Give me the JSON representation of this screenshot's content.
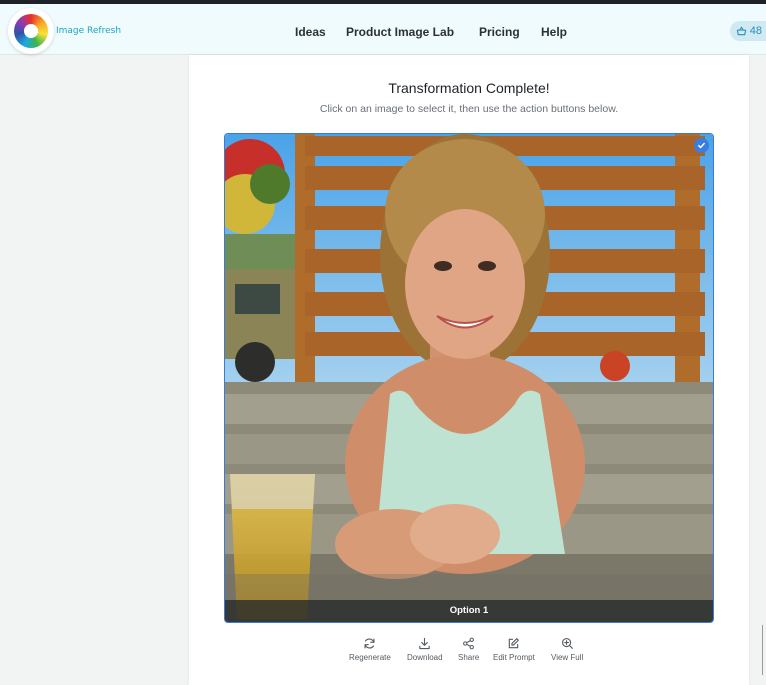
{
  "header": {
    "logo_text": "Image Refresh",
    "nav": [
      "Ideas",
      "Product Image Lab",
      "Pricing",
      "Help"
    ],
    "credits": "48"
  },
  "main": {
    "title": "Transformation Complete!",
    "subtitle": "Click on an image to select it, then use the action buttons below.",
    "image_caption": "Option 1",
    "actions": [
      "Regenerate",
      "Download",
      "Share",
      "Edit Prompt",
      "View Full"
    ]
  },
  "colors": {
    "accent": "#3b7ddd",
    "header_bg": "#effbfc",
    "logo_text": "#1aa6c8"
  }
}
